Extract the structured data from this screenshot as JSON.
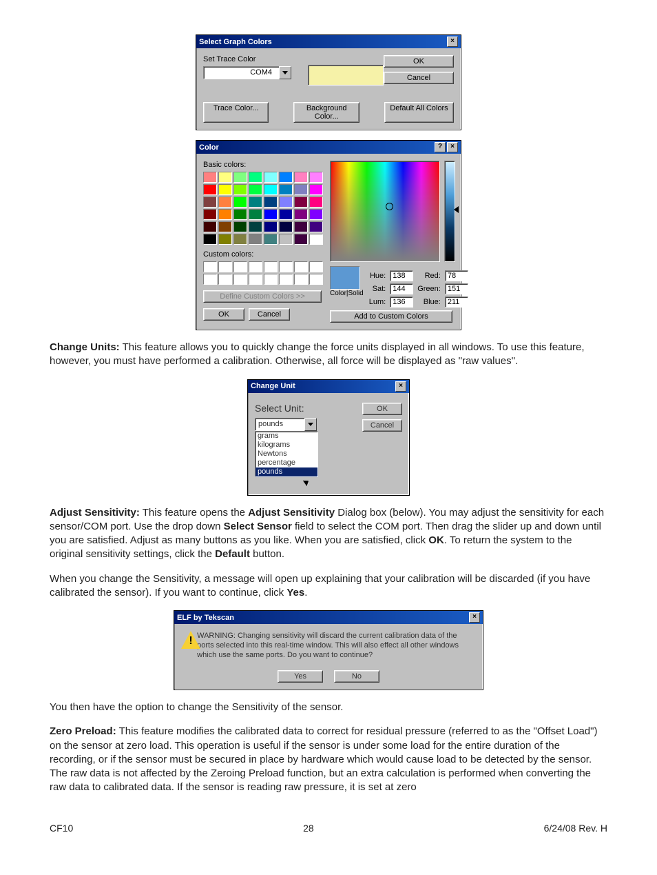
{
  "dialog_graph": {
    "title": "Select Graph Colors",
    "set_trace_label": "Set Trace Color",
    "combo_value": "COM4",
    "ok_label": "OK",
    "cancel_label": "Cancel",
    "trace_color_btn": "Trace Color...",
    "background_color_btn": "Background Color...",
    "default_all_btn": "Default All Colors"
  },
  "dialog_color": {
    "title": "Color",
    "basic_label": "Basic colors:",
    "custom_label": "Custom colors:",
    "define_custom_btn": "Define Custom Colors >>",
    "ok_label": "OK",
    "cancel_label": "Cancel",
    "color_solid_label": "Color|Solid",
    "hue_label": "Hue:",
    "sat_label": "Sat:",
    "lum_label": "Lum:",
    "red_label": "Red:",
    "green_label": "Green:",
    "blue_label": "Blue:",
    "hue_value": "138",
    "sat_value": "144",
    "lum_value": "136",
    "red_value": "78",
    "green_value": "151",
    "blue_value": "211",
    "add_custom_btn": "Add to Custom Colors",
    "basic_colors": [
      "#ff8080",
      "#ffff80",
      "#80ff80",
      "#00ff80",
      "#80ffff",
      "#0080ff",
      "#ff80c0",
      "#ff80ff",
      "#ff0000",
      "#ffff00",
      "#80ff00",
      "#00ff40",
      "#00ffff",
      "#0080c0",
      "#8080c0",
      "#ff00ff",
      "#804040",
      "#ff8040",
      "#00ff00",
      "#008080",
      "#004080",
      "#8080ff",
      "#800040",
      "#ff0080",
      "#800000",
      "#ff8000",
      "#008000",
      "#008040",
      "#0000ff",
      "#0000a0",
      "#800080",
      "#8000ff",
      "#400000",
      "#804000",
      "#004000",
      "#004040",
      "#000080",
      "#000040",
      "#400040",
      "#400080",
      "#000000",
      "#808000",
      "#808040",
      "#808080",
      "#408080",
      "#c0c0c0",
      "#400040",
      "#ffffff"
    ]
  },
  "paragraph1": "Change Units: This feature allows you to quickly change the force units displayed in all windows. To use this feature, however, you must have performed a calibration. Otherwise, all force will be displayed as \"raw values\".",
  "dialog_unit": {
    "title": "Change Unit",
    "select_label": "Select Unit:",
    "current": "pounds",
    "options": [
      "grams",
      "kilograms",
      "Newtons",
      "percentage",
      "pounds"
    ],
    "ok_label": "OK",
    "cancel_label": "Cancel"
  },
  "paragraph2": "Adjust Sensitivity: This feature opens the Adjust Sensitivity Dialog box (below). You may adjust the sensitivity for each sensor/COM port. Use the drop down Select Sensor field to select the COM port. Then drag the slider up and down until you are satisfied. Adjust as many buttons as you like. When you are satisfied, click OK. To return the system to the original sensitivity settings, click the Default button.",
  "paragraph3": "When you change the Sensitivity, a message will open up explaining that your calibration will be discarded (if you have calibrated the sensor). If you want to continue, click Yes.",
  "dialog_elf": {
    "title": "ELF by Tekscan",
    "message": "WARNING: Changing sensitivity will discard the current calibration data of the ports selected into this real-time window. This will also effect all other windows which use the same ports. Do you want to continue?",
    "yes_label": "Yes",
    "no_label": "No"
  },
  "paragraph4": "You then have the option to change the Sensitivity of the sensor.",
  "paragraph5": "Zero Preload: This feature modifies the calibrated data to correct for residual pressure (referred to as the \"Offset Load\") on the sensor at zero load. This operation is useful if the sensor is under some load for the entire duration of the recording, or if the sensor must be secured in place by hardware which would cause load to be detected by the sensor. The raw data is not affected by the Zeroing Preload function, but an extra calculation is performed when converting the raw data to calibrated data. If the sensor is reading raw pressure, it is set at zero",
  "footer": {
    "left": "CF10",
    "center": "28",
    "right": "6/24/08 Rev. H"
  }
}
